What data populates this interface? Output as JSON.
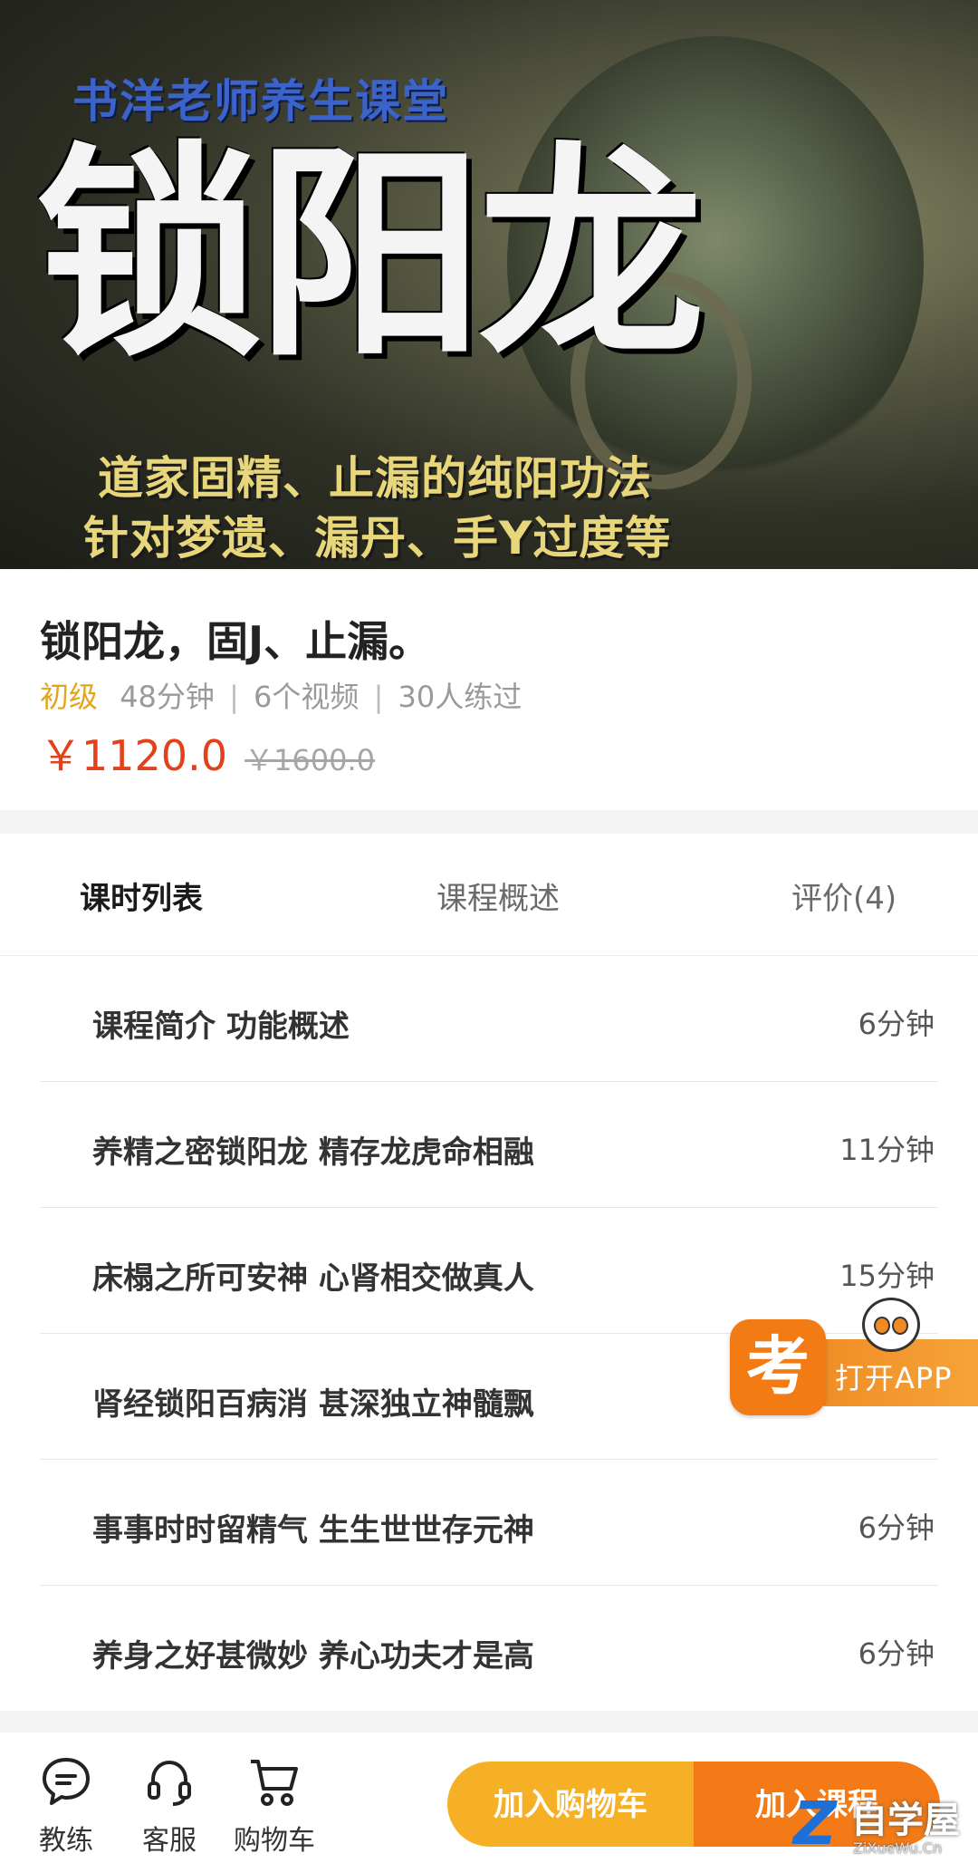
{
  "banner": {
    "top_caption": "书洋老师养生课堂",
    "big_title": "锁阳龙",
    "subtitle_line1": "道家固精、止漏的纯阳功法",
    "subtitle_line2": "针对梦遗、漏丹、手Y过度等"
  },
  "course": {
    "title": "锁阳龙，固J、止漏。",
    "level": "初级",
    "duration": "48分钟",
    "videos": "6个视频",
    "practiced": "30人练过",
    "sep": "|",
    "price": "￥1120.0",
    "original_price": "￥1600.0"
  },
  "tabs": {
    "lessons": "课时列表",
    "overview": "课程概述",
    "reviews": "评价(4)"
  },
  "lessons": [
    {
      "title": "课程简介 功能概述",
      "duration": "6分钟"
    },
    {
      "title": "养精之密锁阳龙 精存龙虎命相融",
      "duration": "11分钟"
    },
    {
      "title": "床榻之所可安神 心肾相交做真人",
      "duration": "15分钟"
    },
    {
      "title": "肾经锁阳百病消 甚深独立神髓飘",
      "duration": ""
    },
    {
      "title": "事事时时留精气 生生世世存元神",
      "duration": "6分钟"
    },
    {
      "title": "养身之好甚微妙 养心功夫才是高",
      "duration": "6分钟"
    }
  ],
  "open_app": {
    "badge": "考",
    "label": "打开APP"
  },
  "bottom_nav": {
    "coach": "教练",
    "service": "客服",
    "cart": "购物车",
    "add_to_cart": "加入购物车",
    "add_course": "加入课程"
  },
  "watermark": {
    "name": "自学屋",
    "url": "ZiXueWu.Cn"
  },
  "colors": {
    "accent_orange": "#f37a16",
    "button_yellow": "#f6b026",
    "price_red": "#e2411a",
    "level_gold": "#e3a51b"
  }
}
